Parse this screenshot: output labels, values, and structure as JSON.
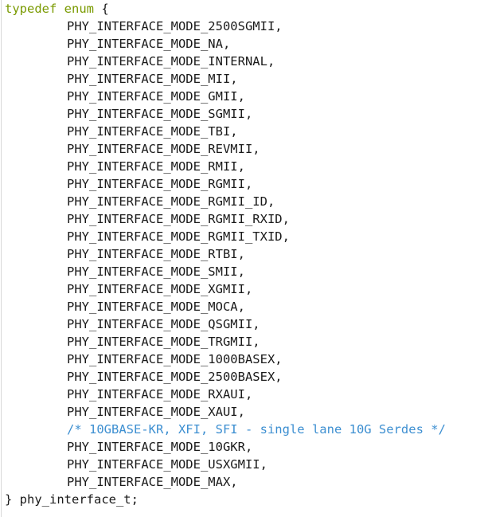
{
  "code": {
    "open_kw": "typedef enum",
    "open_brace": " {",
    "entries": [
      "PHY_INTERFACE_MODE_2500SGMII,",
      "PHY_INTERFACE_MODE_NA,",
      "PHY_INTERFACE_MODE_INTERNAL,",
      "PHY_INTERFACE_MODE_MII,",
      "PHY_INTERFACE_MODE_GMII,",
      "PHY_INTERFACE_MODE_SGMII,",
      "PHY_INTERFACE_MODE_TBI,",
      "PHY_INTERFACE_MODE_REVMII,",
      "PHY_INTERFACE_MODE_RMII,",
      "PHY_INTERFACE_MODE_RGMII,",
      "PHY_INTERFACE_MODE_RGMII_ID,",
      "PHY_INTERFACE_MODE_RGMII_RXID,",
      "PHY_INTERFACE_MODE_RGMII_TXID,",
      "PHY_INTERFACE_MODE_RTBI,",
      "PHY_INTERFACE_MODE_SMII,",
      "PHY_INTERFACE_MODE_XGMII,",
      "PHY_INTERFACE_MODE_MOCA,",
      "PHY_INTERFACE_MODE_QSGMII,",
      "PHY_INTERFACE_MODE_TRGMII,",
      "PHY_INTERFACE_MODE_1000BASEX,",
      "PHY_INTERFACE_MODE_2500BASEX,",
      "PHY_INTERFACE_MODE_RXAUI,",
      "PHY_INTERFACE_MODE_XAUI,",
      "/* 10GBASE-KR, XFI, SFI - single lane 10G Serdes */",
      "PHY_INTERFACE_MODE_10GKR,",
      "PHY_INTERFACE_MODE_USXGMII,",
      "PHY_INTERFACE_MODE_MAX,"
    ],
    "close_line": "} phy_interface_t;"
  },
  "colors": {
    "keyword": "#7a9a01",
    "comment": "#3d8fd1",
    "text": "#1a1a1a",
    "background": "#ffffff"
  }
}
